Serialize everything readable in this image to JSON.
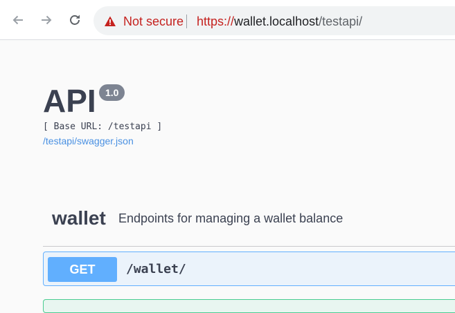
{
  "browser": {
    "security_label": "Not secure",
    "url": {
      "scheme": "https://",
      "host": "wallet.localhost",
      "path": "/testapi/"
    },
    "icons": [
      "back-arrow-icon",
      "forward-arrow-icon",
      "reload-icon",
      "warning-icon"
    ]
  },
  "info": {
    "title": "API",
    "version": "1.0",
    "base_url": "[ Base URL: /testapi ]",
    "spec_link": "/testapi/swagger.json"
  },
  "tags": [
    {
      "name": "wallet",
      "description": "Endpoints for managing a wallet balance",
      "operations": [
        {
          "method": "GET",
          "path": "/wallet/"
        }
      ]
    }
  ],
  "colors": {
    "get": "#61affe",
    "get_bg": "#ebf3fb",
    "post_bg": "#e8f6f0",
    "post_border": "#49cc90",
    "link": "#4990e2",
    "not_secure": "#c5221f"
  }
}
